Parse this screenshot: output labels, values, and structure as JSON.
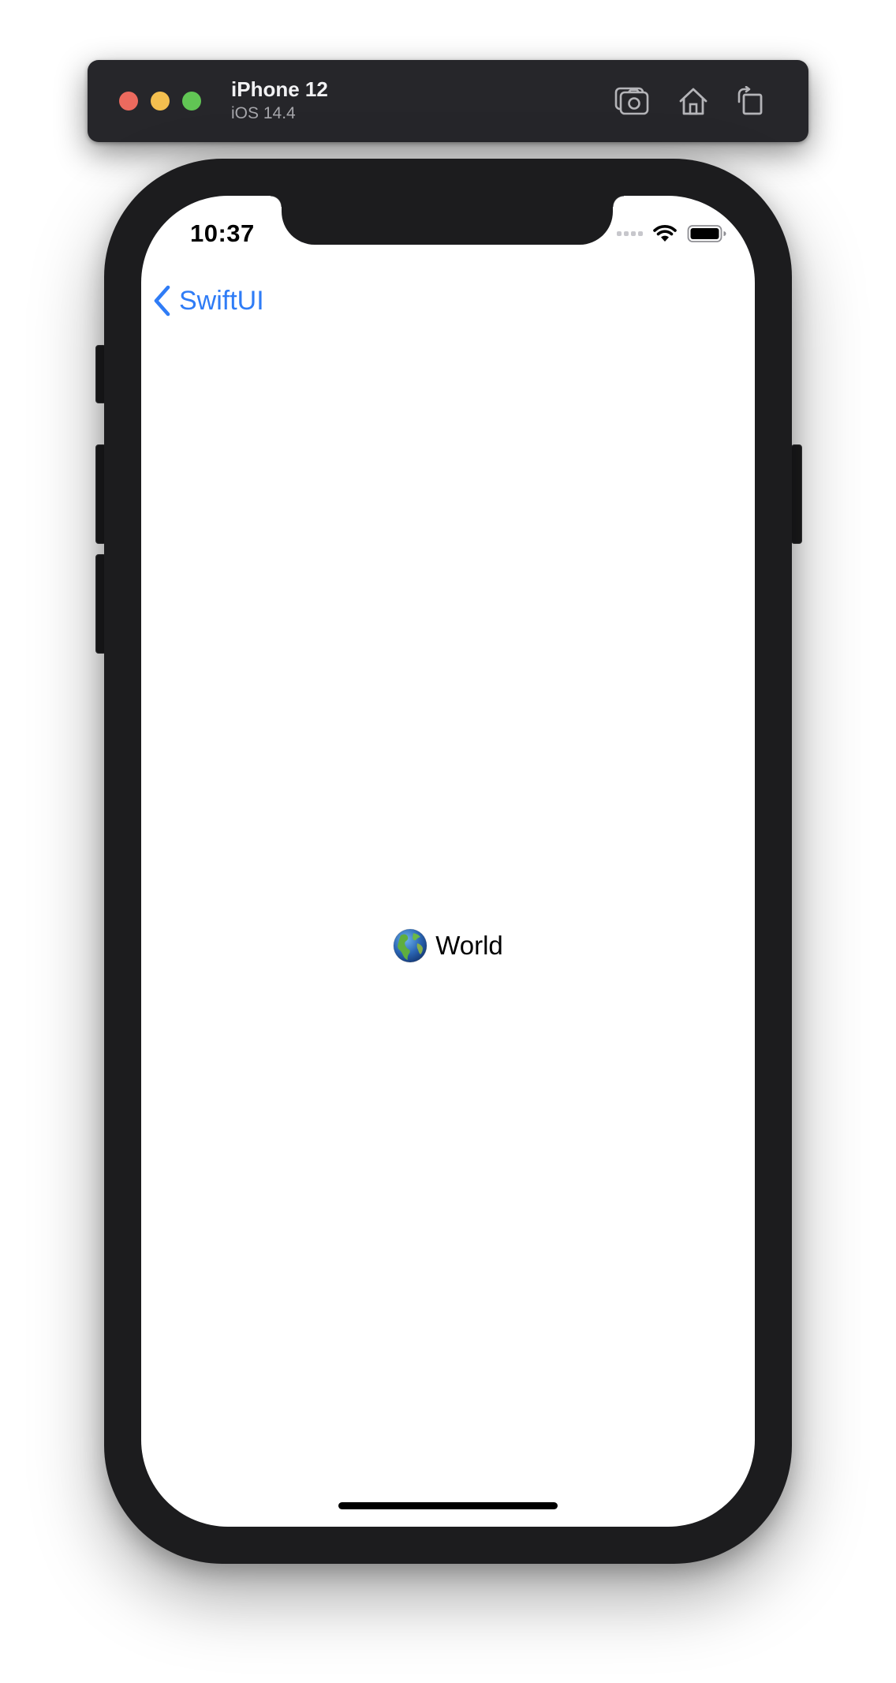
{
  "window": {
    "device_name": "iPhone 12",
    "os_version": "iOS 14.4",
    "controls": [
      "close",
      "minimize",
      "zoom"
    ],
    "toolbar_icons": [
      "screenshot-icon",
      "home-icon",
      "rotate-icon"
    ]
  },
  "status_bar": {
    "time": "10:37",
    "icons": [
      "cellular-signal-icon",
      "wifi-icon",
      "battery-icon"
    ]
  },
  "nav": {
    "back_label": "SwiftUI",
    "back_icon": "chevron-left-icon",
    "accent_color": "#2f7cf6"
  },
  "content": {
    "emoji_icon": "globe-icon",
    "label": "World"
  }
}
